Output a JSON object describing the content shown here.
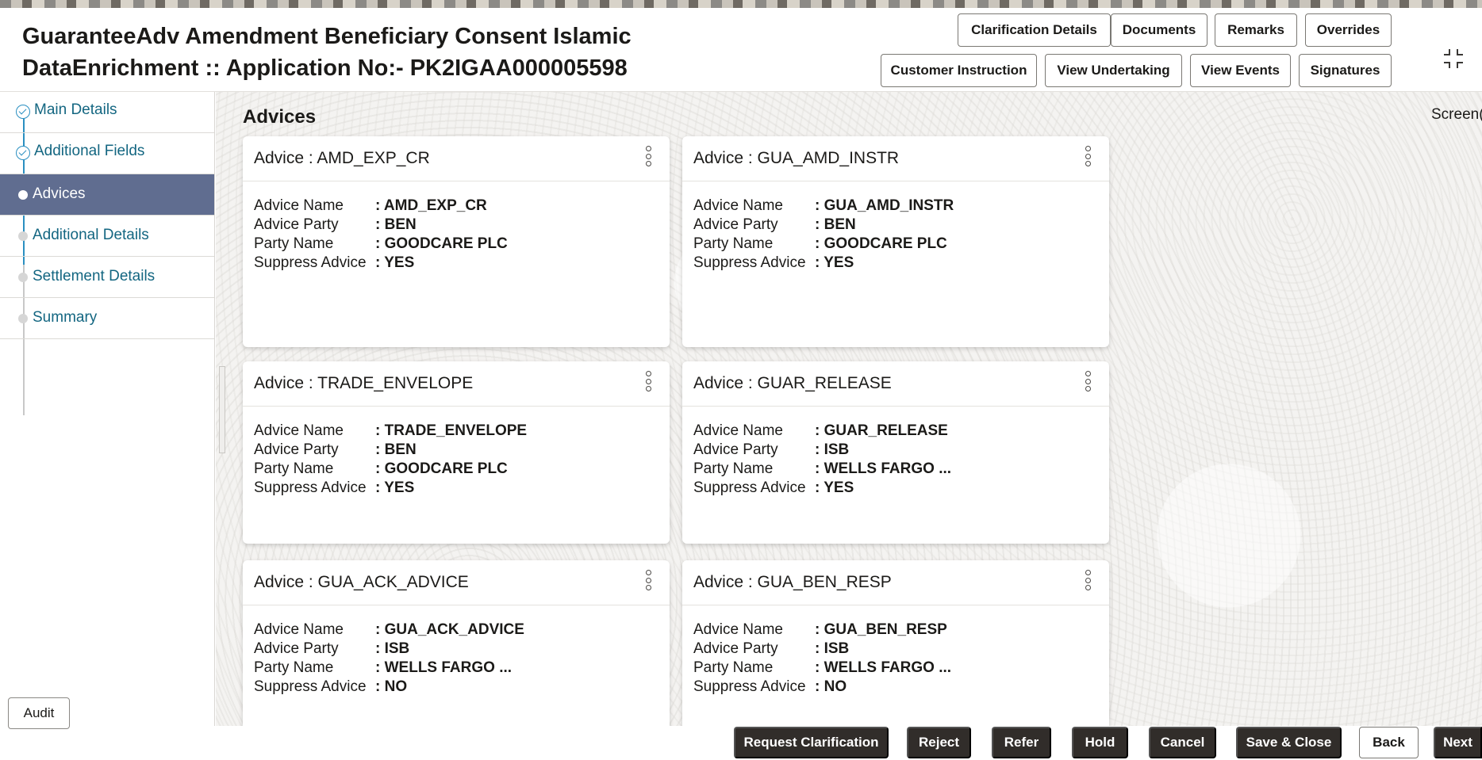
{
  "header": {
    "title_line1": "GuaranteeAdv Amendment Beneficiary Consent Islamic",
    "title_line2": "DataEnrichment :: Application No:- PK2IGAA000005598",
    "buttons_row1": [
      "Clarification Details",
      "Documents",
      "Remarks",
      "Overrides"
    ],
    "buttons_row2": [
      "Customer Instruction",
      "View Undertaking",
      "View Events",
      "Signatures"
    ]
  },
  "sidebar": {
    "items": [
      {
        "label": "Main Details",
        "state": "done"
      },
      {
        "label": "Additional Fields",
        "state": "done"
      },
      {
        "label": "Advices",
        "state": "active"
      },
      {
        "label": "Additional Details",
        "state": "pending"
      },
      {
        "label": "Settlement Details",
        "state": "pending"
      },
      {
        "label": "Summary",
        "state": "pending"
      }
    ],
    "audit_label": "Audit"
  },
  "main": {
    "section_title": "Advices",
    "screen_label": "Screen(",
    "field_labels": {
      "advice_name": "Advice Name",
      "advice_party": "Advice Party",
      "party_name": "Party Name",
      "suppress_advice": "Suppress Advice"
    },
    "cards": [
      {
        "title": "Advice : AMD_EXP_CR",
        "advice_name": ": AMD_EXP_CR",
        "advice_party": ": BEN",
        "party_name": ": GOODCARE PLC",
        "suppress_advice": ": YES"
      },
      {
        "title": "Advice : GUA_AMD_INSTR",
        "advice_name": ": GUA_AMD_INSTR",
        "advice_party": ": BEN",
        "party_name": ": GOODCARE PLC",
        "suppress_advice": ": YES"
      },
      {
        "title": "Advice : TRADE_ENVELOPE",
        "advice_name": ": TRADE_ENVELOPE",
        "advice_party": ": BEN",
        "party_name": ": GOODCARE PLC",
        "suppress_advice": ": YES"
      },
      {
        "title": "Advice : GUAR_RELEASE",
        "advice_name": ": GUAR_RELEASE",
        "advice_party": ": ISB",
        "party_name": ": WELLS FARGO ...",
        "suppress_advice": ": YES"
      },
      {
        "title": "Advice : GUA_ACK_ADVICE",
        "advice_name": ": GUA_ACK_ADVICE",
        "advice_party": ": ISB",
        "party_name": ": WELLS FARGO ...",
        "suppress_advice": ": NO"
      },
      {
        "title": "Advice : GUA_BEN_RESP",
        "advice_name": ": GUA_BEN_RESP",
        "advice_party": ": ISB",
        "party_name": ": WELLS FARGO ...",
        "suppress_advice": ": NO"
      }
    ]
  },
  "footer": {
    "buttons": [
      "Request Clarification",
      "Reject",
      "Refer",
      "Hold",
      "Cancel",
      "Save & Close",
      "Back",
      "Next"
    ]
  },
  "colors": {
    "nav_active_bg": "#606d90",
    "nav_link": "#136681",
    "footer_button_bg": "#312d2a",
    "step_line": "#2a8fc1"
  },
  "icons": {
    "expand": "expand-arrows-icon",
    "kebab": "more-options-icon",
    "step_done": "check-circle-icon",
    "step_pending": "step-dot-icon"
  }
}
